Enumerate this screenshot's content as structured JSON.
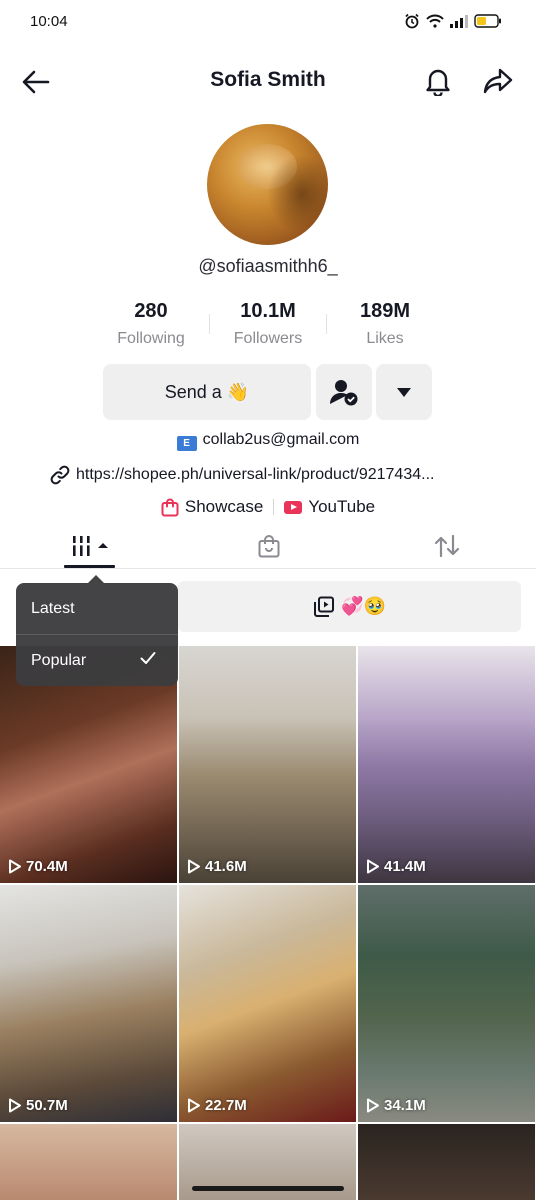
{
  "status_bar": {
    "time": "10:04"
  },
  "header": {
    "title": "Sofia Smith"
  },
  "profile": {
    "username": "@sofiaasmithh6_",
    "stats": [
      {
        "value": "280",
        "label": "Following"
      },
      {
        "value": "10.1M",
        "label": "Followers"
      },
      {
        "value": "189M",
        "label": "Likes"
      }
    ],
    "send_button_label": "Send a 👋",
    "email": "collab2us@gmail.com",
    "email_icon_text": "E",
    "link": "https://shopee.ph/universal-link/product/9217434...",
    "showcase_label": "Showcase",
    "youtube_label": "YouTube"
  },
  "filter": {
    "text": "💞🥹"
  },
  "sort_menu": {
    "items": [
      {
        "label": "Latest",
        "selected": false
      },
      {
        "label": "Popular",
        "selected": true
      }
    ]
  },
  "videos": [
    {
      "views": "70.4M"
    },
    {
      "views": "41.6M"
    },
    {
      "views": "41.4M"
    },
    {
      "views": "50.7M"
    },
    {
      "views": "22.7M"
    },
    {
      "views": "34.1M"
    }
  ],
  "colors": {
    "accent": "#fe2c55",
    "youtube": "#ea3358"
  }
}
